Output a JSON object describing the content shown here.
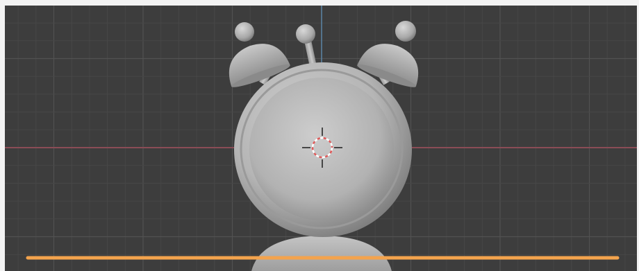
{
  "viewport": {
    "view": "front-orthographic",
    "object_name": "alarm-clock",
    "colors": {
      "background": "#3d3d3d",
      "grid_minor": "#474747",
      "grid_major": "#525252",
      "axis_x": "#8a4c56",
      "axis_z": "#5a84a6",
      "model_light": "#c2c2c2",
      "model_mid": "#a5a5a5",
      "model_dark": "#6e6e6e",
      "selection_outline": "#f3a34d",
      "cursor_red": "#e05a5a",
      "cursor_white": "#ffffff"
    },
    "icons": [
      "3d-cursor-icon"
    ]
  }
}
